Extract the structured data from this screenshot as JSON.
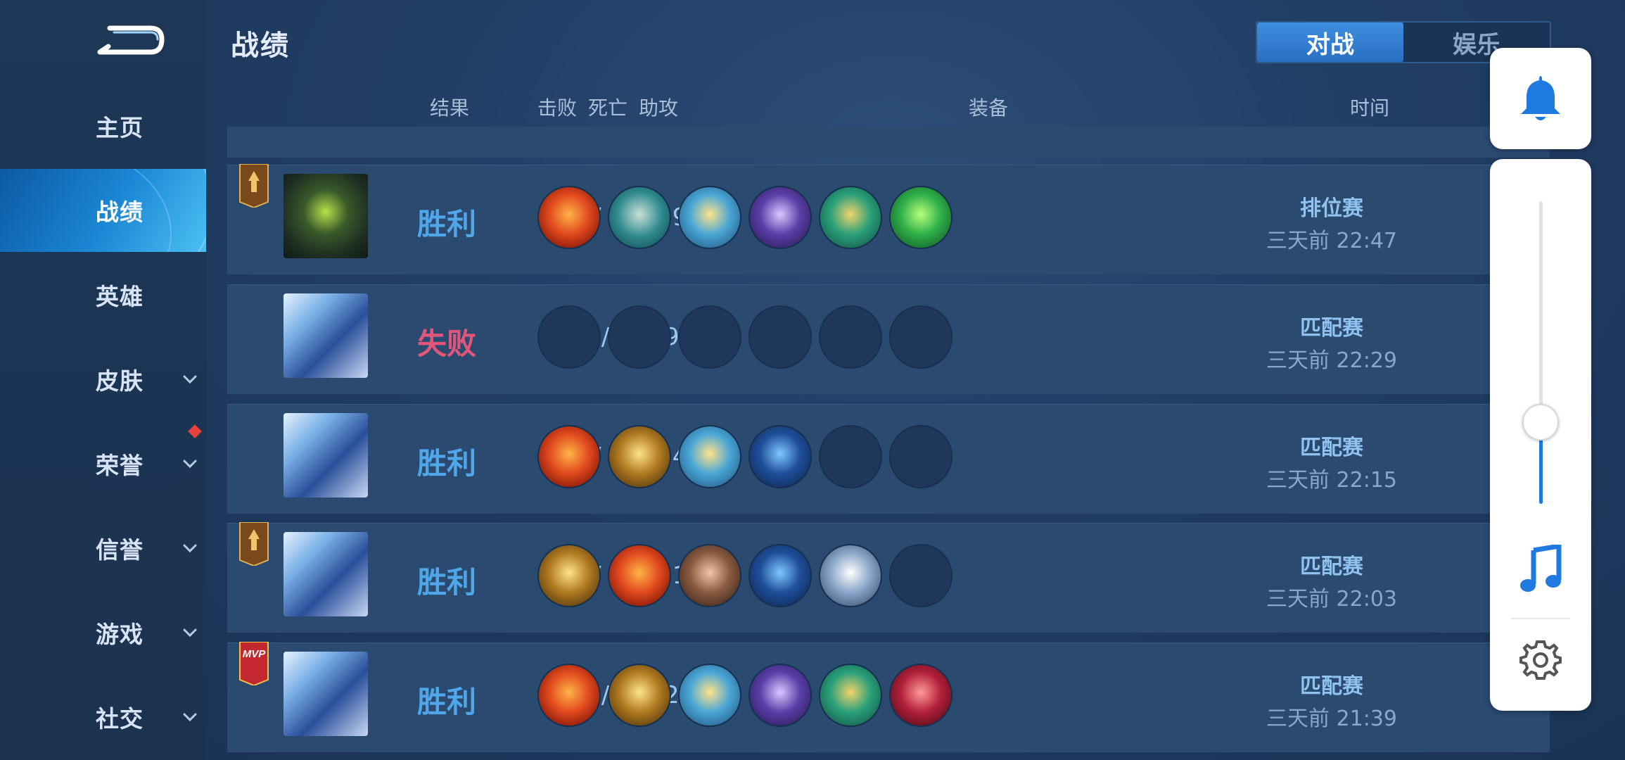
{
  "sidebar": {
    "items": [
      {
        "label": "主页",
        "active": false,
        "chevron": false
      },
      {
        "label": "战绩",
        "active": true,
        "chevron": false
      },
      {
        "label": "英雄",
        "active": false,
        "chevron": false
      },
      {
        "label": "皮肤",
        "active": false,
        "chevron": true
      },
      {
        "label": "荣誉",
        "active": false,
        "chevron": true
      },
      {
        "label": "信誉",
        "active": false,
        "chevron": true
      },
      {
        "label": "游戏",
        "active": false,
        "chevron": true
      },
      {
        "label": "社交",
        "active": false,
        "chevron": true
      }
    ]
  },
  "header": {
    "title": "战绩",
    "tabs": [
      {
        "label": "对战",
        "active": true
      },
      {
        "label": "娱乐",
        "active": false
      }
    ]
  },
  "columns": {
    "result": "结果",
    "kills": "击败",
    "deaths": "死亡",
    "assists": "助攻",
    "items": "装备",
    "time": "时间"
  },
  "colors": {
    "win": "#4fa7ea",
    "loss": "#e2567a",
    "accent": "#1f7ae0"
  },
  "matches": [
    {
      "result": "胜利",
      "outcome": "win",
      "kda": "2  /  2  /  19",
      "mode": "排位赛",
      "time": "三天前 22:47",
      "badge": "rank-badge",
      "items": [
        "fire-orb",
        "boots",
        "golden-mask",
        "purple-helm",
        "gold-ring",
        "green-gem"
      ]
    },
    {
      "result": "失败",
      "outcome": "loss",
      "kda": "5  /  5  /  9",
      "mode": "匹配赛",
      "time": "三天前 22:29",
      "badge": "",
      "items": [
        "empty",
        "empty",
        "empty",
        "empty",
        "empty",
        "empty"
      ]
    },
    {
      "result": "胜利",
      "outcome": "win",
      "kda": "2  /  5  /  14",
      "mode": "匹配赛",
      "time": "三天前 22:15",
      "badge": "",
      "items": [
        "fire-orb",
        "gold-boots",
        "golden-mask",
        "blue-cloak",
        "empty",
        "empty"
      ]
    },
    {
      "result": "胜利",
      "outcome": "win",
      "kda": "3  /  1  /  21",
      "mode": "匹配赛",
      "time": "三天前 22:03",
      "badge": "rank-badge",
      "items": [
        "gold-boots",
        "fire-orb",
        "armor",
        "blue-cloak",
        "silver-shield",
        "empty"
      ]
    },
    {
      "result": "胜利",
      "outcome": "win",
      "kda": "11  /  7  /  20",
      "mode": "匹配赛",
      "time": "三天前 21:39",
      "badge": "mvp-badge",
      "items": [
        "fire-orb",
        "gold-boots",
        "golden-mask",
        "purple-helm",
        "gold-ring",
        "red-claw"
      ]
    }
  ],
  "floating": {
    "icons": [
      "bell-icon",
      "music-note-icon",
      "gear-icon"
    ],
    "volume_level": 0.27
  },
  "badges": {
    "mvp_text": "MVP"
  }
}
